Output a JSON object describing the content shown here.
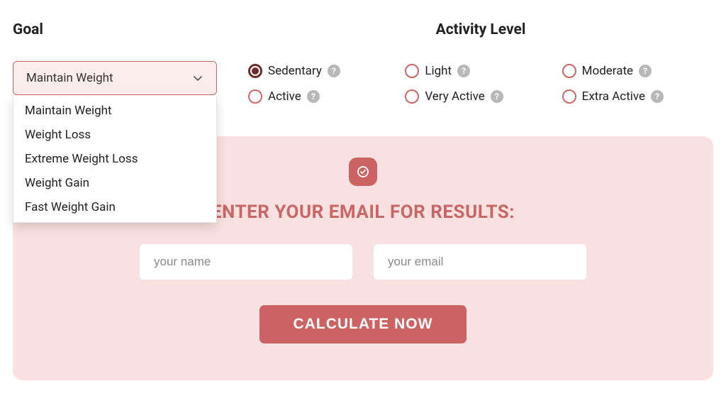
{
  "goal": {
    "label": "Goal",
    "selected": "Maintain Weight",
    "options": [
      "Maintain Weight",
      "Weight Loss",
      "Extreme Weight Loss",
      "Weight Gain",
      "Fast Weight Gain"
    ]
  },
  "activity": {
    "label": "Activity Level",
    "selected": "Sedentary",
    "options": [
      "Sedentary",
      "Light",
      "Moderate",
      "Active",
      "Very Active",
      "Extra Active"
    ]
  },
  "email_panel": {
    "heading": "ENTER YOUR EMAIL FOR RESULTS:",
    "name_placeholder": "your name",
    "email_placeholder": "your email",
    "button": "CALCULATE NOW"
  }
}
